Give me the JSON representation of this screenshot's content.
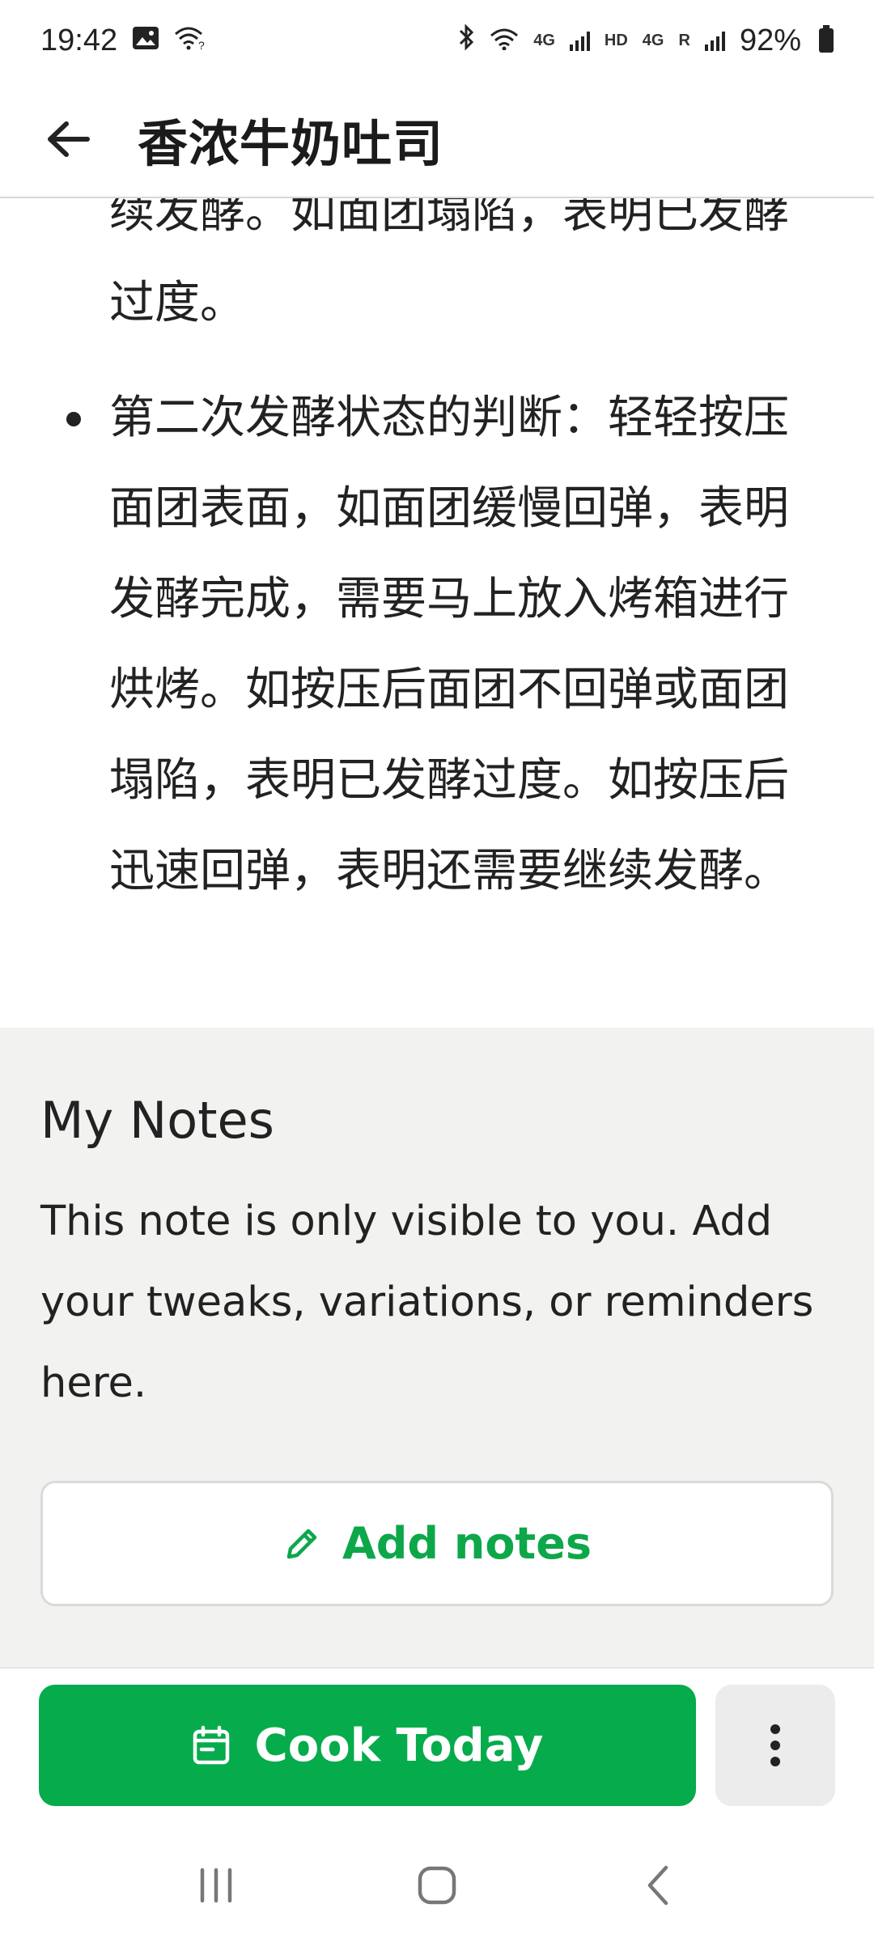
{
  "status_bar": {
    "time": "19:42",
    "battery": "92%",
    "net_4g_1": "4G",
    "net_hd": "HD",
    "net_4g_2": "4G",
    "net_r": "R"
  },
  "header": {
    "title": "香浓牛奶吐司"
  },
  "instructions": [
    "…按压后迅速回弹，表明还需要继续发酵。如面团塌陷，表明已发酵过度。",
    "第二次发酵状态的判断：轻轻按压面团表面，如面团缓慢回弹，表明发酵完成，需要马上放入烤箱进行烘烤。如按压后面团不回弹或面团塌陷，表明已发酵过度。如按压后迅速回弹，表明还需要继续发酵。"
  ],
  "notes": {
    "title": "My Notes",
    "description": "This note is only visible to you. Add your tweaks, variations, or reminders here.",
    "add_button_label": "Add notes"
  },
  "actions": {
    "cook_today_label": "Cook Today"
  },
  "colors": {
    "accent_green": "#06ab4c",
    "notes_background": "#f2f3f1"
  },
  "icons": {
    "back": "arrow-left-icon",
    "add_notes": "pencil-icon",
    "cook_today": "calendar-icon",
    "more": "more-vertical-icon"
  }
}
